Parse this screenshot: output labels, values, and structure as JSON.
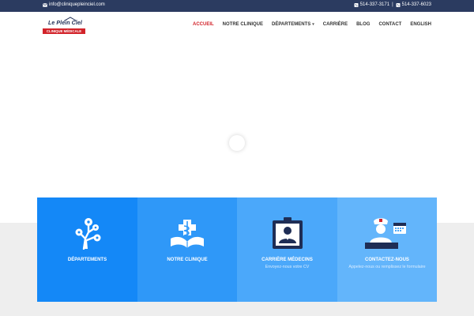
{
  "topbar": {
    "email": "info@cliniquepleinciel.com",
    "phone1": "514-337-3171",
    "separator": "|",
    "phone2": "514-337-6023",
    "color": "#2b3b60"
  },
  "logo": {
    "brand": "Le Plein Ciel",
    "tagline": "CLINIQUE MÉDICALE",
    "brand_color": "#1e2d55",
    "tag_color": "#d2232a"
  },
  "nav": {
    "items": [
      "ACCUEIL",
      "NOTRE CLINIQUE",
      "DÉPARTEMENTS",
      "CARRIÈRE",
      "BLOG",
      "CONTACT",
      "ENGLISH"
    ],
    "active_color": "#d2232a"
  },
  "panels": [
    {
      "title": "DÉPARTEMENTS",
      "subtitle": "",
      "icon": "tree-gears-icon",
      "color": "#1488f7"
    },
    {
      "title": "NOTRE CLINIQUE",
      "subtitle": "",
      "icon": "medical-book-icon",
      "color": "#2f98f8"
    },
    {
      "title": "CARRIÈRE MÉDECINS",
      "subtitle": "Envoyez-nous votre CV",
      "icon": "doctor-badge-icon",
      "color": "#4ba8fa"
    },
    {
      "title": "CONTACTEZ-NOUS",
      "subtitle": "Appelez-nous ou remplissez le formulaire",
      "icon": "nurse-calendar-icon",
      "color": "#63b5fb"
    }
  ]
}
